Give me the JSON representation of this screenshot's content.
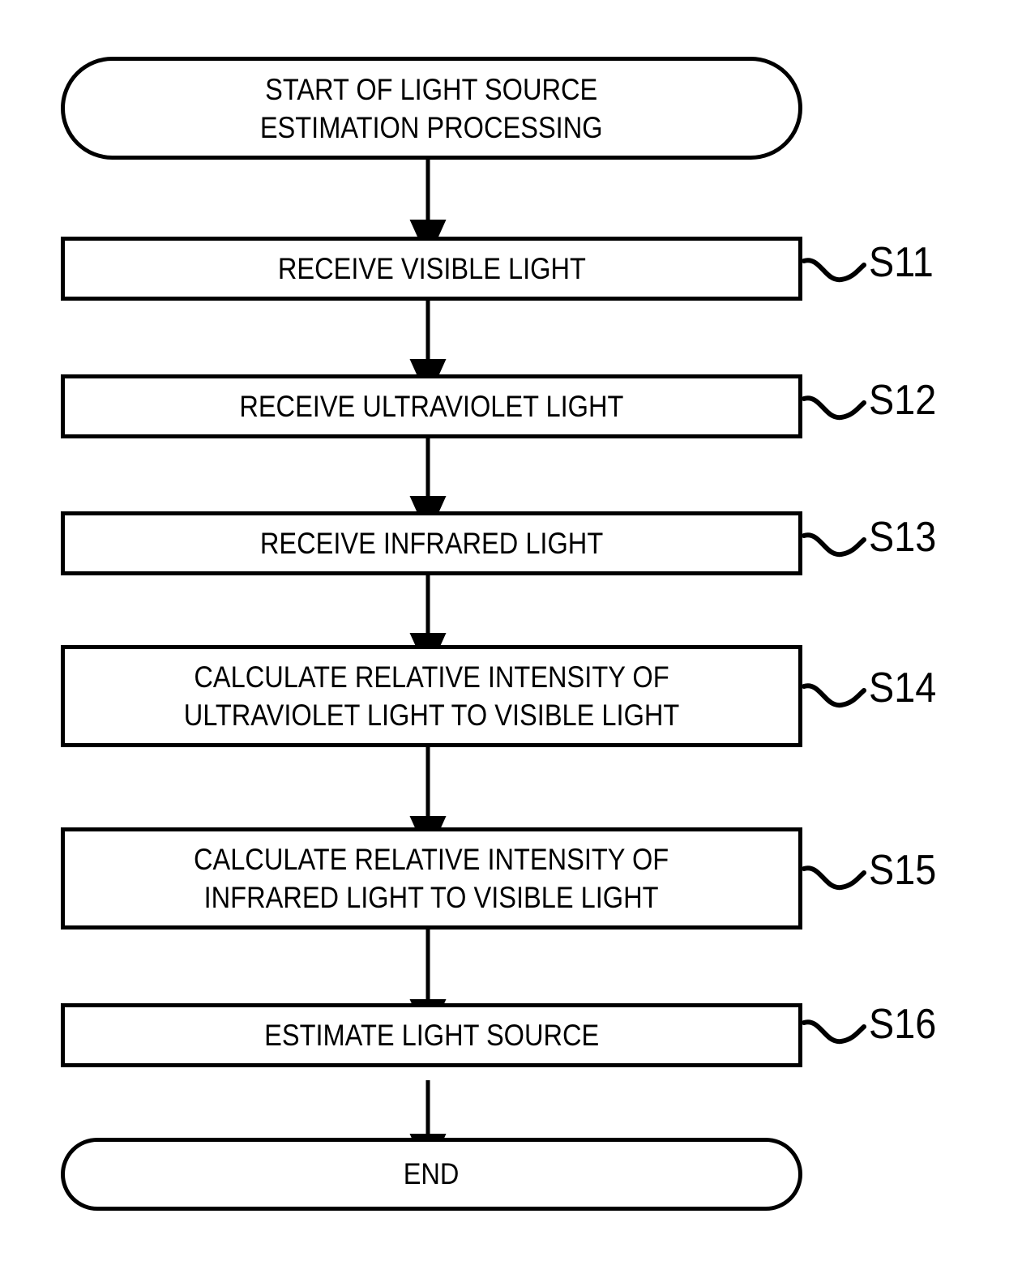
{
  "diagram": {
    "type": "flowchart",
    "orientation": "vertical",
    "nodes": [
      {
        "id": "start",
        "shape": "terminal",
        "text": "START OF LIGHT SOURCE\nESTIMATION PROCESSING",
        "step": ""
      },
      {
        "id": "s11",
        "shape": "process",
        "text": "RECEIVE VISIBLE LIGHT",
        "step": "S11"
      },
      {
        "id": "s12",
        "shape": "process",
        "text": "RECEIVE ULTRAVIOLET LIGHT",
        "step": "S12"
      },
      {
        "id": "s13",
        "shape": "process",
        "text": "RECEIVE INFRARED LIGHT",
        "step": "S13"
      },
      {
        "id": "s14",
        "shape": "process",
        "text": "CALCULATE RELATIVE INTENSITY OF\nULTRAVIOLET LIGHT TO VISIBLE LIGHT",
        "step": "S14"
      },
      {
        "id": "s15",
        "shape": "process",
        "text": "CALCULATE RELATIVE INTENSITY OF\nINFRARED LIGHT TO VISIBLE LIGHT",
        "step": "S15"
      },
      {
        "id": "s16",
        "shape": "process",
        "text": "ESTIMATE LIGHT SOURCE",
        "step": "S16"
      },
      {
        "id": "end",
        "shape": "terminal",
        "text": "END",
        "step": ""
      }
    ],
    "edges": [
      {
        "from": "start",
        "to": "s11"
      },
      {
        "from": "s11",
        "to": "s12"
      },
      {
        "from": "s12",
        "to": "s13"
      },
      {
        "from": "s13",
        "to": "s14"
      },
      {
        "from": "s14",
        "to": "s15"
      },
      {
        "from": "s15",
        "to": "s16"
      },
      {
        "from": "s16",
        "to": "end"
      }
    ],
    "colors": {
      "stroke": "#000000",
      "fill": "#ffffff",
      "text": "#000000"
    }
  }
}
